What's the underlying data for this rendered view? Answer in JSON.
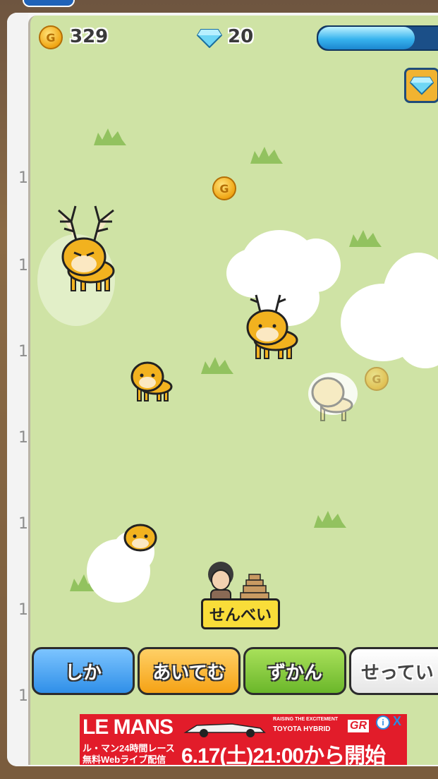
{
  "hud": {
    "coins": "329",
    "gems": "20",
    "energy_fraction": 0.72,
    "coin_symbol": "G"
  },
  "field_coins": [
    {
      "symbol": "G"
    },
    {
      "symbol": "G"
    }
  ],
  "seller": {
    "sign_label": "せんべい"
  },
  "nav": {
    "deer_label": "しか",
    "items_label": "あいてむ",
    "zukan_label": "ずかん",
    "settings_label": "せってい"
  },
  "ad": {
    "brand": "LE MANS",
    "tagline_small": "RAISING THE EXCITEMENT",
    "tagline_team": "TOYOTA HYBRID",
    "gr_logo": "GR",
    "line1": "ル・マン24時間レース",
    "line2": "無料Webライブ配信",
    "date_text": "6.17(土)21:00から開始",
    "info_icon": "i",
    "close_icon": "X"
  },
  "side_numbers": [
    "1",
    "1",
    "1",
    "1",
    "1",
    "1",
    "1"
  ],
  "colors": {
    "field": "#cfe3a5",
    "deer_body": "#f2b21f",
    "deer_btn": "#2f8fe8",
    "items_btn": "#f5a215",
    "zukan_btn": "#6bb72a",
    "settings_btn": "#e6e6e6"
  }
}
